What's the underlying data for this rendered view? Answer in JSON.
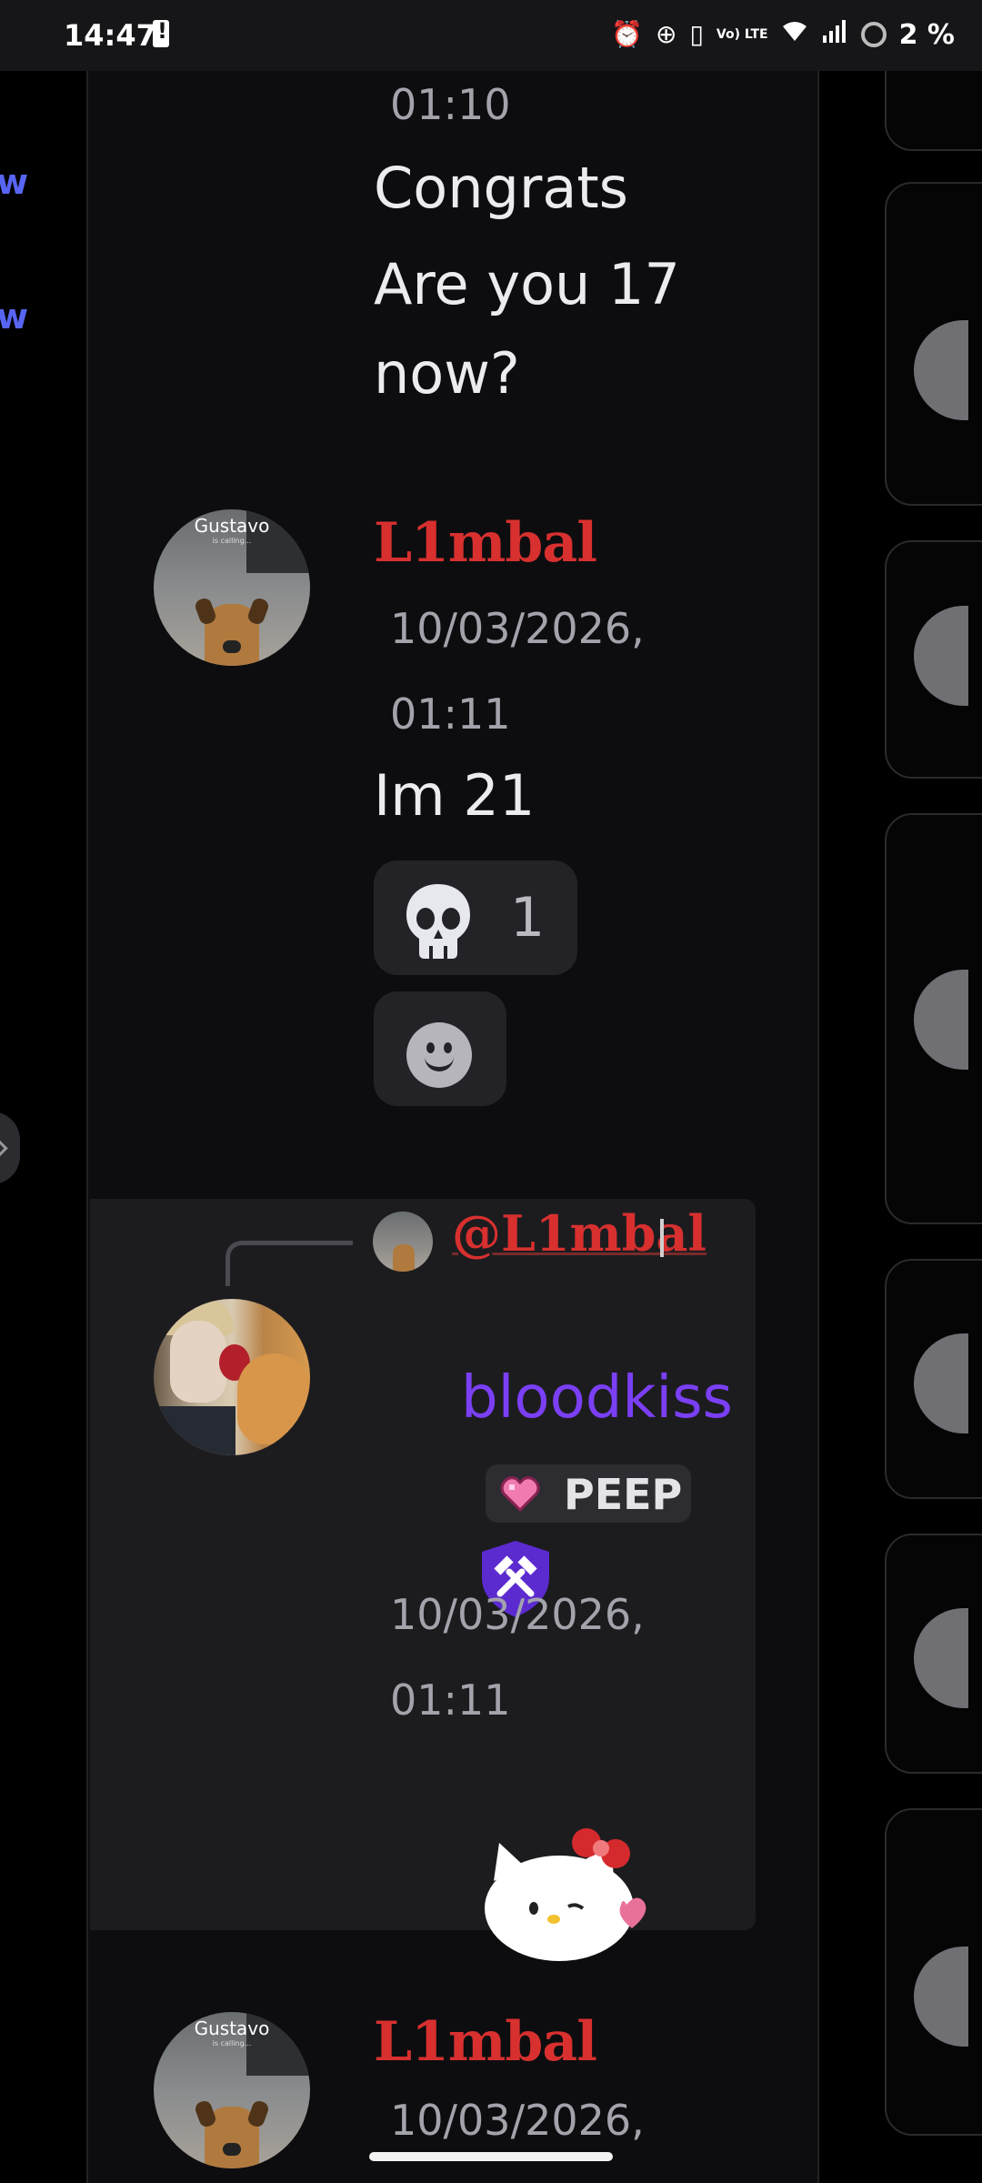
{
  "status_bar": {
    "time": "14:47",
    "battery_percent": "2 %",
    "icons": [
      "battery-alert-icon",
      "alarm-icon",
      "data-saver-icon",
      "vibrate-icon",
      "volte-icon",
      "wifi-icon",
      "signal-icon",
      "battery-ring-icon"
    ],
    "volte_label": "Vo) LTE"
  },
  "left_sidebar": {
    "fragments": [
      "w",
      "w"
    ]
  },
  "messages": [
    {
      "timestamp_line2": "01:10",
      "lines": [
        "Congrats",
        "Are you 17",
        "now?"
      ]
    },
    {
      "author": "L1mbal",
      "avatar_label": "Gustavo",
      "avatar_sub": "is calling...",
      "timestamp_line1": "10/03/2026,",
      "timestamp_line2": "01:11",
      "text": "Im 21",
      "reaction": {
        "emoji": "skull",
        "count": "1"
      }
    },
    {
      "reply_to": "@L1mbal",
      "author": "bloodkiss",
      "tag": "PEEP",
      "timestamp_line1": "10/03/2026,",
      "timestamp_line2": "01:11",
      "sticker": "hello-kitty-wink"
    },
    {
      "author": "L1mbal",
      "avatar_label": "Gustavo",
      "avatar_sub": "is calling...",
      "timestamp_line1": "10/03/2026,"
    }
  ],
  "colors": {
    "accent_blurple": "#5865f2",
    "limbal_red": "#d7302f",
    "bloodkiss_purple": "#7b3ff5",
    "background": "#0d0d0f"
  }
}
